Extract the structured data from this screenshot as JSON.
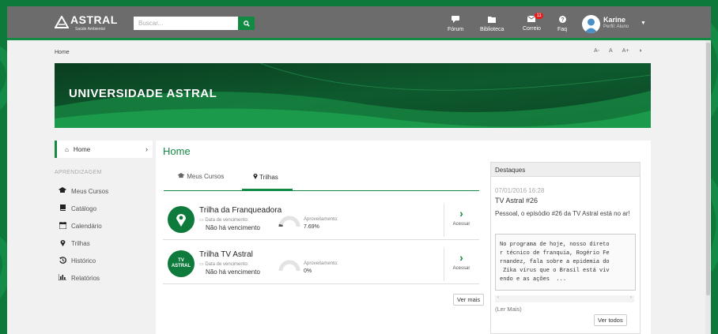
{
  "app": {
    "brand": "ASTRAL",
    "brand_sub": "Saúde Ambiental",
    "brand_color": "#118a43"
  },
  "search": {
    "placeholder": "Buscar..."
  },
  "nav": {
    "items": [
      {
        "label": "Fórum",
        "icon": "chat-icon"
      },
      {
        "label": "Biblioteca",
        "icon": "folder-icon"
      },
      {
        "label": "Correio",
        "icon": "mail-icon",
        "badge": "11"
      },
      {
        "label": "Faq",
        "icon": "question-icon"
      }
    ]
  },
  "user": {
    "name": "Karine",
    "role": "Perfil: Aluno"
  },
  "breadcrumb": "Home",
  "font_controls": [
    "A-",
    "A",
    "A+",
    "◑"
  ],
  "banner": {
    "title": "UNIVERSIDADE ASTRAL"
  },
  "sidebar": {
    "home": "Home",
    "section": "APRENDIZAGEM",
    "items": [
      {
        "label": "Meus Cursos",
        "icon": "graduation-cap-icon"
      },
      {
        "label": "Catálogo",
        "icon": "book-icon"
      },
      {
        "label": "Calendário",
        "icon": "calendar-icon"
      },
      {
        "label": "Trilhas",
        "icon": "map-marker-icon"
      },
      {
        "label": "Histórico",
        "icon": "history-icon"
      },
      {
        "label": "Relatórios",
        "icon": "bar-chart-icon"
      }
    ]
  },
  "main": {
    "title": "Home",
    "tabs": [
      {
        "label": "Meus Cursos",
        "active": false
      },
      {
        "label": "Trilhas",
        "active": true
      }
    ],
    "cards": [
      {
        "title": "Trilha da Franqueadora",
        "due_label": "Data de vencimento:",
        "due_value": "Não há vencimento",
        "perf_label": "Aproveitamento:",
        "perf_value": "7.69%",
        "progress": 0.0769,
        "access": "Acessar",
        "icon": "map-marker-icon"
      },
      {
        "title": "Trilha TV Astral",
        "due_label": "Data de vencimento:",
        "due_value": "Não há vencimento",
        "perf_label": "Aproveitamento:",
        "perf_value": "0%",
        "progress": 0,
        "access": "Acessar",
        "icon": "tv-astral-logo",
        "logo_text": [
          "TV",
          "ASTRAL"
        ]
      }
    ],
    "see_more": "Ver mais"
  },
  "highlights": {
    "heading": "Destaques",
    "date": "07/01/2016 16:28",
    "title": "TV Astral #26",
    "desc": "Pessoal, o episódio #26 da TV Astral está no ar!",
    "body": "No programa de hoje, nosso direto\nr técnico de franquia, Rogério Fe\nrnandez, fala sobre a epidemia do\n Zika vírus que o Brasil está viv\nendo e as ações  ...",
    "read_more": "(Ler Mais)",
    "see_all": "Ver todos"
  }
}
